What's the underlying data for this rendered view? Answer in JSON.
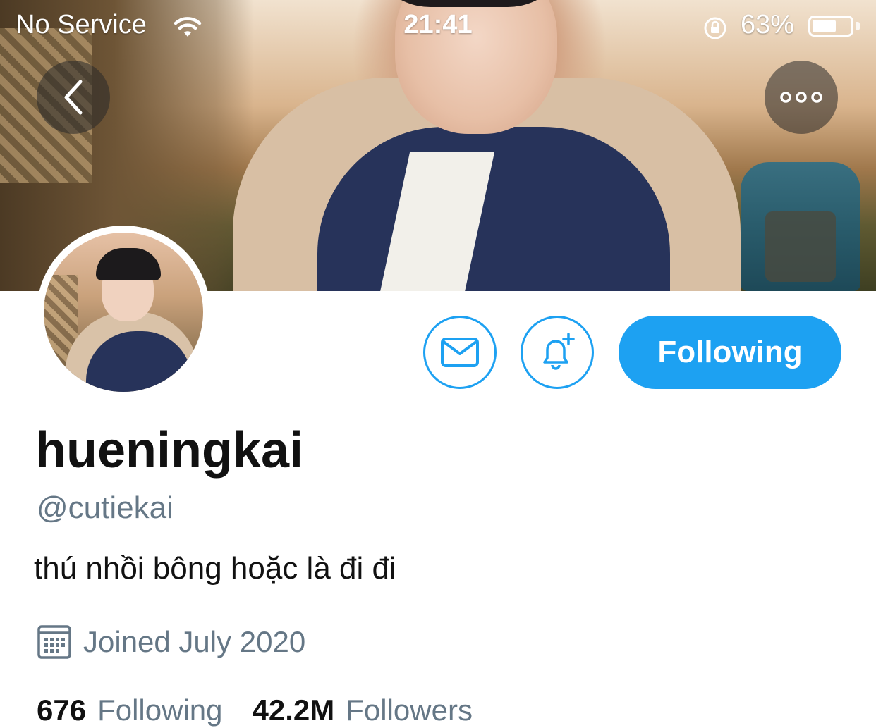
{
  "status_bar": {
    "carrier": "No Service",
    "time": "21:41",
    "battery_percent": "63%",
    "battery_level": 0.63,
    "icons": [
      "wifi-icon",
      "rotation-lock-icon",
      "battery-icon"
    ]
  },
  "nav": {
    "back_icon": "chevron-left-icon",
    "more_icon": "more-horizontal-icon"
  },
  "actions": {
    "message_icon": "envelope-icon",
    "notify_icon": "bell-plus-icon",
    "follow_label": "Following"
  },
  "profile": {
    "display_name": "hueningkai",
    "handle": "@cutiekai",
    "bio": "thú nhồi bông hoặc là đi đi",
    "joined": "Joined July 2020",
    "joined_icon": "calendar-icon"
  },
  "stats": {
    "following_count": "676",
    "following_label": "Following",
    "followers_count": "42.2M",
    "followers_label": "Followers"
  },
  "colors": {
    "accent": "#1da1f2",
    "secondary_text": "#657786",
    "primary_text": "#111111"
  }
}
